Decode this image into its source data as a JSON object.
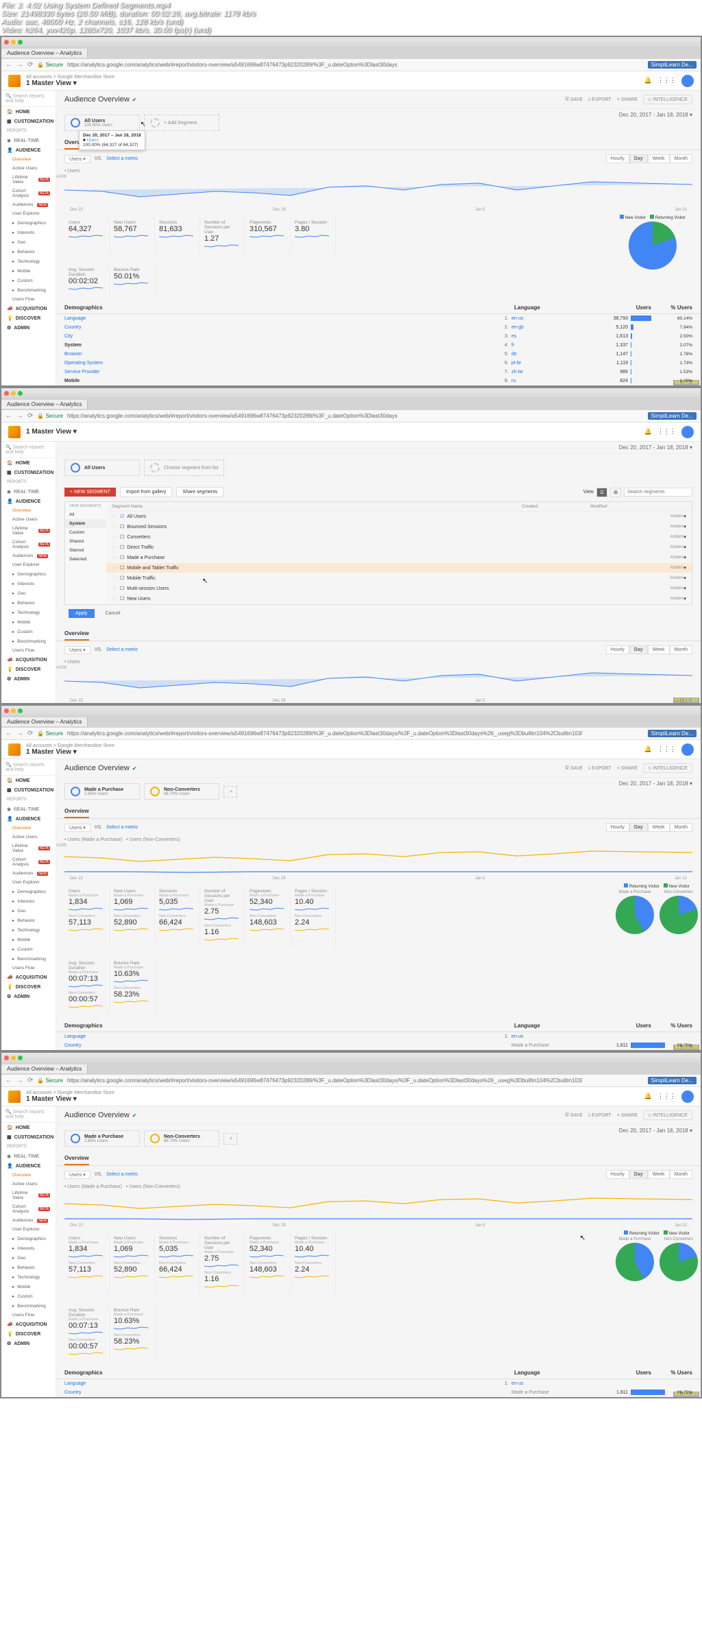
{
  "overlay": {
    "file": "File: 2. 4.02 Using System Defined Segments.mp4",
    "size": "Size: 21498330 bytes (20.50 MiB), duration: 00:02:26, avg.bitrate: 1178 kb/s",
    "audio": "Audio: aac, 48000 Hz, 2 channels, s16, 128 kb/s (und)",
    "video": "Video: h264, yuv420p, 1280x720, 1037 kb/s, 30.00 fps(r) (und)"
  },
  "common": {
    "tab_title": "Audience Overview – Analytics",
    "secure": "Secure",
    "url_base": "https://analytics.google.com/analytics/web/#report/visitors-overview/a5491696w87476473p92320289/%3F_u.dateOption%3Dlast30days",
    "extension_name": "SimpliLearn De...",
    "crumb": "All accounts > Google Merchandise Store",
    "view": "1 Master View",
    "search_placeholder": "Search reports and help",
    "page_title": "Audience Overview",
    "date_range": "Dec 20, 2017 - Jan 18, 2018",
    "actions": {
      "save": "SAVE",
      "export": "EXPORT",
      "share": "SHARE",
      "intel": "INTELLIGENCE"
    },
    "overview_tab": "Overview",
    "users_vs": "Users",
    "vs": "VS.",
    "select_metric": "Select a metric",
    "time_btns": [
      "Hourly",
      "Day",
      "Week",
      "Month"
    ],
    "chart_x": [
      "Dec 22",
      "Dec 29",
      "Jan 5",
      "Jan 12"
    ]
  },
  "sidebar": {
    "home": "HOME",
    "custom": "CUSTOMIZATION",
    "reports": "Reports",
    "realtime": "REAL-TIME",
    "audience": "AUDIENCE",
    "overview": "Overview",
    "active": "Active Users",
    "ltv": "Lifetime Value",
    "cohort": "Cohort Analysis",
    "audiences": "Audiences",
    "explorer": "User Explorer",
    "demo": "Demographics",
    "interests": "Interests",
    "geo": "Geo",
    "behavior": "Behavior",
    "tech": "Technology",
    "mobile": "Mobile",
    "custom2": "Custom",
    "bench": "Benchmarking",
    "flow": "Users Flow",
    "acq": "ACQUISITION",
    "disc": "DISCOVER",
    "admin": "ADMIN",
    "new": "NEW",
    "beta": "BETA"
  },
  "panel1": {
    "seg_all": "All Users",
    "seg_all_pct": "100.00% Users",
    "add_seg": "+ Add Segment",
    "tooltip_date": "Dec 20, 2017 – Jan 18, 2018",
    "tooltip_seg": "Users",
    "tooltip_val": "100.00% (64,327 of 64,327)",
    "chart_title": "Users",
    "chart_max": "4,000",
    "kpis": [
      {
        "l": "Users",
        "v": "64,327"
      },
      {
        "l": "New Users",
        "v": "58,767"
      },
      {
        "l": "Sessions",
        "v": "81,633"
      },
      {
        "l": "Number of Sessions per User",
        "v": "1.27"
      },
      {
        "l": "Pageviews",
        "v": "310,567"
      },
      {
        "l": "Pages / Session",
        "v": "3.80"
      }
    ],
    "kpis2": [
      {
        "l": "Avg. Session Duration",
        "v": "00:02:02"
      },
      {
        "l": "Bounce Rate",
        "v": "50.01%"
      }
    ],
    "pie_legend": [
      "New Visitor",
      "Returning Visitor"
    ],
    "demo_h": [
      "Demographics",
      "Language",
      "Users",
      "% Users"
    ],
    "demo_dims": [
      "Language",
      "Country",
      "City",
      "System",
      "Browser",
      "Operating System",
      "Service Provider",
      "Mobile"
    ],
    "demo_rows": [
      {
        "r": "1.",
        "d": "en-us",
        "u": "38,793",
        "p": "60.14%",
        "w": 60
      },
      {
        "r": "2.",
        "d": "en-gb",
        "u": "5,120",
        "p": "7.94%",
        "w": 8
      },
      {
        "r": "3.",
        "d": "es",
        "u": "1,613",
        "p": "2.50%",
        "w": 3
      },
      {
        "r": "4.",
        "d": "fr",
        "u": "1,337",
        "p": "2.07%",
        "w": 2
      },
      {
        "r": "5.",
        "d": "de",
        "u": "1,147",
        "p": "1.78%",
        "w": 2
      },
      {
        "r": "6.",
        "d": "pt-br",
        "u": "1,119",
        "p": "1.73%",
        "w": 2
      },
      {
        "r": "7.",
        "d": "zh-tw",
        "u": "985",
        "p": "1.53%",
        "w": 2
      },
      {
        "r": "8.",
        "d": "ru",
        "u": "824",
        "p": "1.28%",
        "w": 1
      }
    ],
    "ts": "00:00:00"
  },
  "panel2": {
    "url_ext": "/",
    "seg_all": "All Users",
    "choose": "Choose segment from list",
    "new_seg": "+ NEW SEGMENT",
    "import": "Import from gallery",
    "share": "Share segments",
    "view": "View",
    "search_ph": "Search segments",
    "cats": [
      "VIEW SEGMENTS",
      "All",
      "System",
      "Custom",
      "Shared",
      "Starred",
      "Selected"
    ],
    "list_head": [
      "Segment Name",
      "Created",
      "Modified"
    ],
    "rows": [
      {
        "n": "All Users",
        "sel": true
      },
      {
        "n": "Bounced Sessions"
      },
      {
        "n": "Converters"
      },
      {
        "n": "Direct Traffic"
      },
      {
        "n": "Made a Purchase"
      },
      {
        "n": "Mobile and Tablet Traffic",
        "hl": true
      },
      {
        "n": "Mobile Traffic"
      },
      {
        "n": "Multi-session Users"
      },
      {
        "n": "New Users"
      }
    ],
    "actions_label": "Actions",
    "apply": "Apply",
    "cancel": "Cancel",
    "overview": "Overview",
    "chart_title": "Users",
    "chart_max": "4,000",
    "ts": "00:01:02"
  },
  "panel3": {
    "url_ext": "/%3F_u.dateOption%3Dlast30days%26_.useg%3Dbuiltin104%2Cbuiltin103/",
    "seg1": "Made a Purchase",
    "seg1_pct": "2.85% Users",
    "seg2": "Non-Converters",
    "seg2_pct": "88.70% Users",
    "chart_legend": [
      "Users (Made a Purchase)",
      "Users (Non-Converters)"
    ],
    "chart_max": "4,000",
    "kpis": [
      {
        "l": "Users",
        "s1": "Made a Purchase",
        "v1": "1,834",
        "s2": "Non-Converters",
        "v2": "57,113"
      },
      {
        "l": "New Users",
        "s1": "Made a Purchase",
        "v1": "1,069",
        "s2": "Non-Converters",
        "v2": "52,890"
      },
      {
        "l": "Sessions",
        "s1": "Made a Purchase",
        "v1": "5,035",
        "s2": "Non-Converters",
        "v2": "66,424"
      },
      {
        "l": "Number of Sessions per User",
        "s1": "Made a Purchase",
        "v1": "2.75",
        "s2": "Non-Converters",
        "v2": "1.16"
      },
      {
        "l": "Pageviews",
        "s1": "Made a Purchase",
        "v1": "52,340",
        "s2": "Non-Converters",
        "v2": "148,603"
      },
      {
        "l": "Pages / Session",
        "s1": "Made a Purchase",
        "v1": "10.40",
        "s2": "Non-Converters",
        "v2": "2.24"
      }
    ],
    "kpis2": [
      {
        "l": "Avg. Session Duration",
        "s1": "Made a Purchase",
        "v1": "00:07:13",
        "s2": "Non-Converters",
        "v2": "00:00:57"
      },
      {
        "l": "Bounce Rate",
        "s1": "Made a Purchase",
        "v1": "10.63%",
        "s2": "Non-Converters",
        "v2": "58.23%"
      }
    ],
    "pie_legend": [
      "Returning Visitor",
      "New Visitor"
    ],
    "pie_labels": [
      "Made a Purchase",
      "Non-Converters"
    ],
    "demo_h": [
      "Demographics",
      "Language",
      "Users",
      "% Users"
    ],
    "demo_dims": [
      "Language",
      "Country"
    ],
    "demo_row": {
      "r": "1.",
      "d": "en-us",
      "seg": "Made a Purchase",
      "u": "1,811",
      "p": "98.75%",
      "w": 99
    },
    "ts": "00:01:58"
  },
  "panel4": {
    "ts": "00:02:03"
  },
  "chart_data": {
    "type": "line",
    "panel1_series": {
      "name": "Users",
      "x": [
        "Dec 20",
        "Dec 22",
        "Dec 24",
        "Dec 26",
        "Dec 28",
        "Dec 30",
        "Jan 1",
        "Jan 3",
        "Jan 5",
        "Jan 7",
        "Jan 9",
        "Jan 11",
        "Jan 13",
        "Jan 15",
        "Jan 17"
      ],
      "values": [
        2100,
        1900,
        1400,
        1700,
        2000,
        1800,
        1600,
        2300,
        2400,
        2100,
        2500,
        2600,
        2100,
        2400,
        2700
      ],
      "ylim": [
        0,
        4000
      ]
    },
    "panel3_series": [
      {
        "name": "Made a Purchase",
        "values": [
          80,
          70,
          50,
          60,
          75,
          70,
          55,
          90,
          95,
          85,
          100,
          105,
          80,
          95,
          110
        ]
      },
      {
        "name": "Non-Converters",
        "values": [
          1900,
          1750,
          1300,
          1550,
          1800,
          1650,
          1450,
          2100,
          2200,
          1900,
          2300,
          2400,
          1950,
          2200,
          2500
        ]
      }
    ],
    "pie_panel1": {
      "type": "pie",
      "labels": [
        "New Visitor",
        "Returning Visitor"
      ],
      "values": [
        80.5,
        19.5
      ]
    },
    "pie_panel3": [
      {
        "name": "Made a Purchase",
        "type": "pie",
        "labels": [
          "Returning Visitor",
          "New Visitor"
        ],
        "values": [
          42,
          58
        ]
      },
      {
        "name": "Non-Converters",
        "type": "pie",
        "labels": [
          "Returning Visitor",
          "New Visitor"
        ],
        "values": [
          20,
          80
        ]
      }
    ]
  }
}
